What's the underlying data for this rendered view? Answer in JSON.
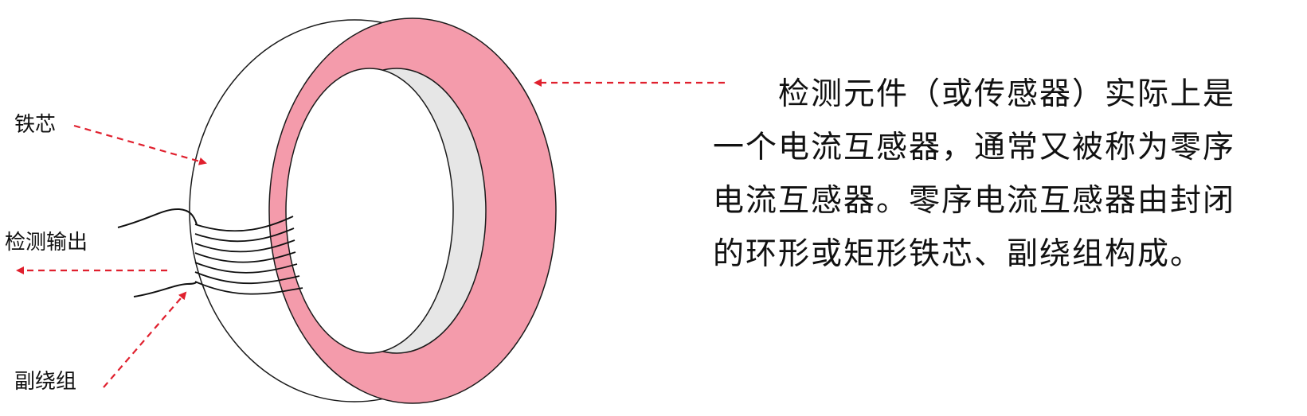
{
  "labels": {
    "core": "铁芯",
    "output": "检测输出",
    "winding": "副绕组"
  },
  "description": {
    "lines": [
      "　　检测元件（或传感器）实际上是",
      "一个电流互感器，通常又被称为零序",
      "电流互感器。零序电流互感器由封闭",
      "的环形或矩形铁芯、副绕组构成。"
    ]
  },
  "colors": {
    "ring_face": "#f49bab",
    "ring_inner": "#e6e6e6",
    "arrow": "#e0202e",
    "outline": "#1a1a1a"
  }
}
